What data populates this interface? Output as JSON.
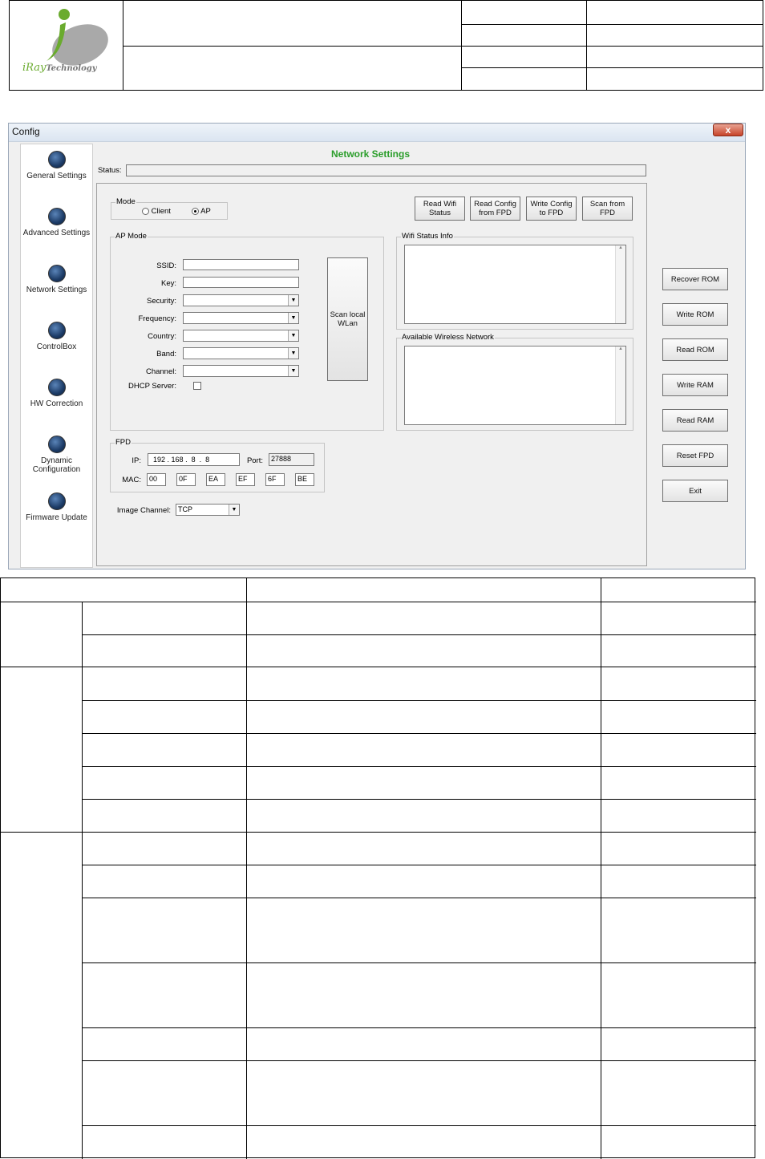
{
  "header": {
    "logo_text_main": "iRay",
    "logo_text_sub": "Technology",
    "brand_color": "#6aab2e"
  },
  "window": {
    "title": "Config",
    "close_label": "x",
    "heading": "Network Settings",
    "status_label": "Status:",
    "status_value": ""
  },
  "sidebar": {
    "items": [
      {
        "label": "General Settings",
        "icon": "general-settings-icon"
      },
      {
        "label": "Advanced Settings",
        "icon": "advanced-settings-icon"
      },
      {
        "label": "Network Settings",
        "icon": "network-settings-icon"
      },
      {
        "label": "ControlBox",
        "icon": "controlbox-icon"
      },
      {
        "label": "HW Correction",
        "icon": "hw-correction-icon"
      },
      {
        "label": "Dynamic Configuration",
        "icon": "dynamic-configuration-icon"
      },
      {
        "label": "Firmware Update",
        "icon": "firmware-update-icon"
      }
    ]
  },
  "mode": {
    "label": "Mode",
    "client_label": "Client",
    "ap_label": "AP",
    "selected": "AP"
  },
  "top_buttons": {
    "read_wifi": "Read Wifi\nStatus",
    "read_config": "Read Config\nfrom FPD",
    "write_config": "Write Config\nto FPD",
    "scan_fpd": "Scan from\nFPD"
  },
  "ap_mode": {
    "label": "AP Mode",
    "ssid_label": "SSID:",
    "key_label": "Key:",
    "security_label": "Security:",
    "frequency_label": "Frequency:",
    "country_label": "Country:",
    "band_label": "Band:",
    "channel_label": "Channel:",
    "dhcp_label": "DHCP Server:",
    "scan_wlan": "Scan local\nWLan"
  },
  "wifi_status": {
    "label": "Wifi Status Info"
  },
  "available_networks": {
    "label": "Available Wireless Network"
  },
  "fpd": {
    "label": "FPD",
    "ip_label": "IP:",
    "ip": [
      "192",
      "168",
      "8",
      "8"
    ],
    "port_label": "Port:",
    "port": "27888",
    "mac_label": "MAC:",
    "mac": [
      "00",
      "0F",
      "EA",
      "EF",
      "6F",
      "BE"
    ]
  },
  "image_channel": {
    "label": "Image Channel:",
    "value": "TCP"
  },
  "right_buttons": {
    "recover_rom": "Recover ROM",
    "write_rom": "Write ROM",
    "read_rom": "Read ROM",
    "write_ram": "Write RAM",
    "read_ram": "Read RAM",
    "reset_fpd": "Reset FPD",
    "exit": "Exit"
  }
}
